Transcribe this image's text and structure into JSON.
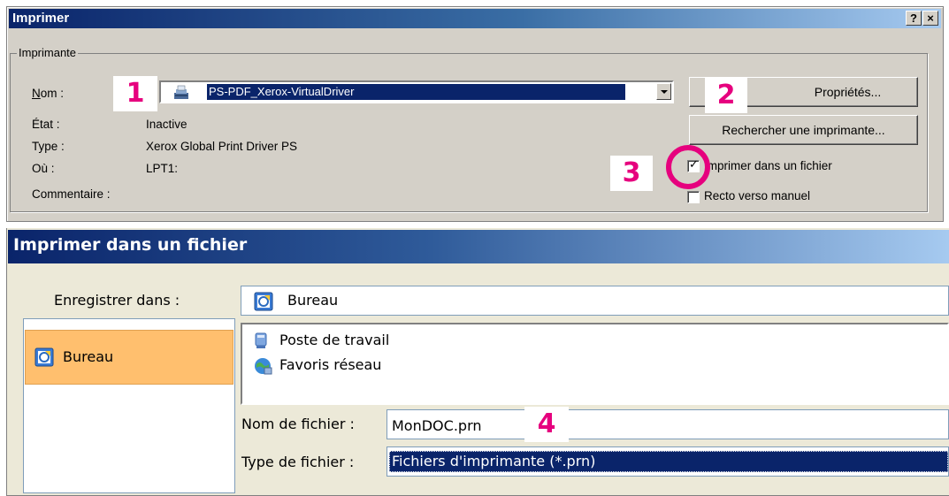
{
  "print_dialog": {
    "title": "Imprimer",
    "help_button": "?",
    "close_button": "×",
    "group_label": "Imprimante",
    "name_label_u": "N",
    "name_label_rest": "om :",
    "printer_name": "PS-PDF_Xerox-VirtualDriver",
    "status_label": "État :",
    "status_value": "Inactive",
    "type_label": "Type :",
    "type_value": "Xerox Global Print Driver PS",
    "where_label": "Où :",
    "where_value": "LPT1:",
    "comment_label": "Commentaire :",
    "properties_button": "Propriétés...",
    "find_printer_button": "Rechercher une imprimante...",
    "print_to_file_label": "Imprimer dans un fichier",
    "print_to_file_checked": true,
    "manual_duplex_label": "Recto verso manuel",
    "manual_duplex_checked": false
  },
  "annotations": {
    "step1": "1",
    "step2": "2",
    "step3": "3",
    "step4": "4",
    "accent_color": "#e6007e"
  },
  "file_dialog": {
    "title": "Imprimer dans un fichier",
    "save_in_label": "Enregistrer dans :",
    "save_in_value": "Bureau",
    "places": [
      {
        "label": "Bureau",
        "icon": "desktop-icon",
        "selected": true
      }
    ],
    "items": [
      {
        "label": "Poste de travail",
        "icon": "my-computer-icon"
      },
      {
        "label": "Favoris réseau",
        "icon": "network-places-icon"
      }
    ],
    "filename_label": "Nom de fichier :",
    "filename_value": "MonDOC.prn",
    "filetype_label": "Type de fichier :",
    "filetype_value": "Fichiers d'imprimante (*.prn)"
  }
}
